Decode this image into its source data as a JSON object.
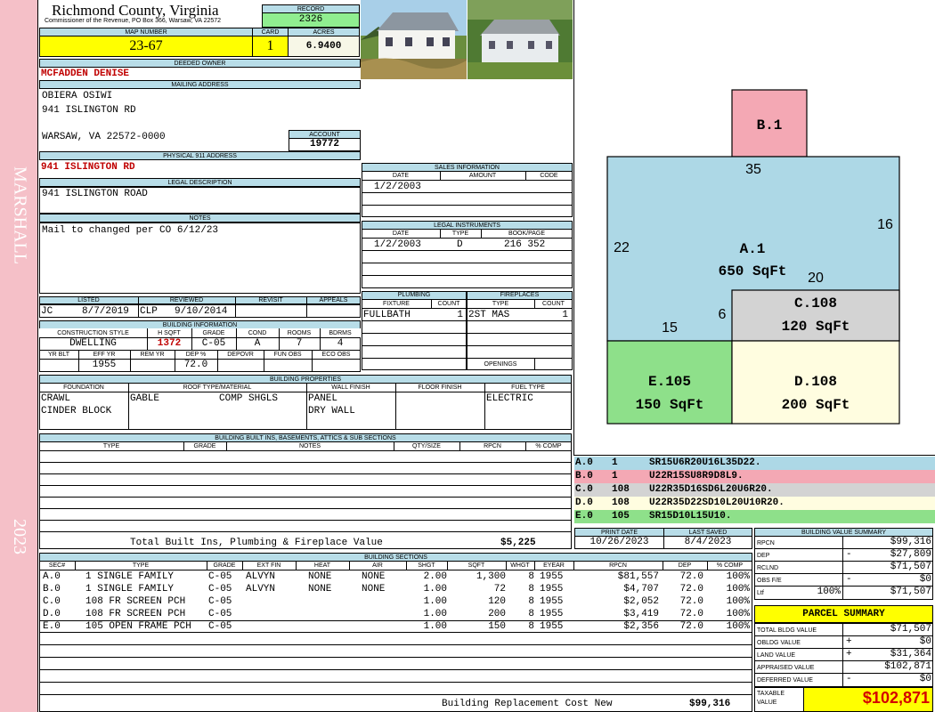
{
  "sidebar": {
    "subdivision": "MARSHALL",
    "year": "2023"
  },
  "header": {
    "county": "Richmond County, Virginia",
    "address_line": "Commissioner of the Revenue, PO Box 366, Warsaw, VA 22572",
    "record_label": "RECORD",
    "record": "2326",
    "map_label": "MAP NUMBER",
    "map_number": "23-67",
    "card_label": "CARD",
    "card": "1",
    "acres_label": "ACRES",
    "acres": "6.9400"
  },
  "owner": {
    "deeded_label": "DEEDED OWNER",
    "deeded_owner": "MCFADDEN DENISE",
    "mailing_label": "MAILING ADDRESS",
    "mail_line1": "OBIERA OSIWI",
    "mail_line2": "941 ISLINGTON RD",
    "mail_line3": "WARSAW, VA 22572-0000",
    "account_label": "ACCOUNT",
    "account": "19772",
    "physical_label": "PHYSICAL 911 ADDRESS",
    "physical_address": "941 ISLINGTON RD",
    "legal_label": "LEGAL DESCRIPTION",
    "legal": "941 ISLINGTON ROAD",
    "notes_label": "NOTES",
    "notes": "Mail to changed per CO 6/12/23"
  },
  "sales": {
    "title": "SALES INFORMATION",
    "cols": [
      "DATE",
      "AMOUNT",
      "CODE"
    ],
    "date": "1/2/2003",
    "amount": "",
    "code": ""
  },
  "legal_inst": {
    "title": "LEGAL INSTRUMENTS",
    "cols": [
      "DATE",
      "TYPE",
      "BOOK/PAGE"
    ],
    "date": "1/2/2003",
    "type": "D",
    "bookpage": "216 352"
  },
  "listed": {
    "labels": [
      "LISTED",
      "REVIEWED",
      "REVISIT",
      "APPEALS"
    ],
    "listed_by": "JC",
    "listed_date": "8/7/2019",
    "reviewed_by": "CLP",
    "reviewed_date": "9/10/2014"
  },
  "plumbing": {
    "title": "PLUMBING",
    "cols": [
      "FIXTURE",
      "COUNT"
    ],
    "fixture": "FULLBATH",
    "count": "1"
  },
  "fireplaces": {
    "title": "FIREPLACES",
    "cols": [
      "TYPE",
      "COUNT"
    ],
    "type": "2ST MAS",
    "count": "1",
    "openings": "OPENINGS"
  },
  "building_info": {
    "title": "BUILDING INFORMATION",
    "cols": [
      "CONSTRUCTION STYLE",
      "H SQFT",
      "GRADE",
      "COND",
      "ROOMS",
      "BDRMS"
    ],
    "style": "DWELLING",
    "hsqft": "1372",
    "grade": "C-05",
    "cond": "A",
    "rooms": "7",
    "bdrms": "4",
    "cols2": [
      "YR BLT",
      "EFF YR",
      "REM YR",
      "DEP %",
      "DEPOVR",
      "FUN OBS",
      "ECO OBS"
    ],
    "eff_yr": "1955",
    "dep": "72.0"
  },
  "properties": {
    "title": "BUILDING PROPERTIES",
    "cols": [
      "FOUNDATION",
      "ROOF TYPE/MATERIAL",
      "WALL FINISH",
      "FLOOR FINISH",
      "FUEL TYPE"
    ],
    "foundation1": "CRAWL",
    "foundation2": "CINDER BLOCK",
    "roof_type": "GABLE",
    "roof_mat": "COMP SHGLS",
    "wall1": "PANEL",
    "wall2": "DRY WALL",
    "fuel": "ELECTRIC"
  },
  "builtins": {
    "title": "BUILDING BUILT INS, BASEMENTS, ATTICS & SUB SECTIONS",
    "cols": [
      "TYPE",
      "GRADE",
      "NOTES",
      "QTY/SIZE",
      "RPCN",
      "% COMP"
    ],
    "total_label": "Total Built Ins, Plumbing & Fireplace Value",
    "total": "$5,225"
  },
  "print": {
    "print_label": "PRINT DATE",
    "print_date": "10/26/2023",
    "saved_label": "LAST SAVED",
    "saved_date": "8/4/2023"
  },
  "sections": {
    "title": "BUILDING SECTIONS",
    "cols": [
      "SEC#",
      "TYPE",
      "GRADE",
      "EXT FIN",
      "HEAT",
      "AIR",
      "SHGT",
      "SQFT",
      "WHGT",
      "EYEAR",
      "RPCN",
      "DEP",
      "% COMP"
    ],
    "rows": [
      {
        "sec": "A.0",
        "type": "1 SINGLE FAMILY",
        "grade": "C-05",
        "ext": "ALVYN",
        "heat": "NONE",
        "air": "NONE",
        "shgt": "2.00",
        "sqft": "1,300",
        "whgt": "8",
        "eyear": "1955",
        "rpcn": "$81,557",
        "dep": "72.0",
        "comp": "100%"
      },
      {
        "sec": "B.0",
        "type": "1 SINGLE FAMILY",
        "grade": "C-05",
        "ext": "ALVYN",
        "heat": "NONE",
        "air": "NONE",
        "shgt": "1.00",
        "sqft": "72",
        "whgt": "8",
        "eyear": "1955",
        "rpcn": "$4,707",
        "dep": "72.0",
        "comp": "100%"
      },
      {
        "sec": "C.0",
        "type": "108 FR SCREEN PCH",
        "grade": "C-05",
        "ext": "",
        "heat": "",
        "air": "",
        "shgt": "1.00",
        "sqft": "120",
        "whgt": "8",
        "eyear": "1955",
        "rpcn": "$2,052",
        "dep": "72.0",
        "comp": "100%"
      },
      {
        "sec": "D.0",
        "type": "108 FR SCREEN PCH",
        "grade": "C-05",
        "ext": "",
        "heat": "",
        "air": "",
        "shgt": "1.00",
        "sqft": "200",
        "whgt": "8",
        "eyear": "1955",
        "rpcn": "$3,419",
        "dep": "72.0",
        "comp": "100%"
      },
      {
        "sec": "E.0",
        "type": "105 OPEN FRAME PCH",
        "grade": "C-05",
        "ext": "",
        "heat": "",
        "air": "",
        "shgt": "1.00",
        "sqft": "150",
        "whgt": "8",
        "eyear": "1955",
        "rpcn": "$2,356",
        "dep": "72.0",
        "comp": "100%"
      }
    ],
    "total_label": "Building Replacement Cost New",
    "total": "$99,316"
  },
  "sketch": {
    "labels": {
      "b": "B.1",
      "a1": "A.1",
      "a2": "650 SqFt",
      "c1": "C.108",
      "c2": "120 SqFt",
      "d1": "D.108",
      "d2": "200 SqFt",
      "e1": "E.105",
      "e2": "150 SqFt"
    },
    "dims": {
      "d35": "35",
      "d16": "16",
      "d22": "22",
      "d20": "20",
      "d6": "6",
      "d15": "15"
    },
    "colors": {
      "a": "#add8e6",
      "b": "#f4a8b4",
      "c": "#d3d3d3",
      "d": "#fffde0",
      "e": "#8ee08a"
    },
    "vectors": [
      {
        "sec": "A.0",
        "code": "1",
        "path": "SR15U6R20U16L35D22."
      },
      {
        "sec": "B.0",
        "code": "1",
        "path": "U22R15SU8R9D8L9."
      },
      {
        "sec": "C.0",
        "code": "108",
        "path": "U22R35D16SD6L20U6R20."
      },
      {
        "sec": "D.0",
        "code": "108",
        "path": "U22R35D22SD10L20U10R20."
      },
      {
        "sec": "E.0",
        "code": "105",
        "path": "SR15D10L15U10."
      }
    ]
  },
  "bv": {
    "title": "BUILDING VALUE SUMMARY",
    "rpcn_label": "RPCN",
    "rpcn": "$99,316",
    "dep_label": "DEP",
    "dep_sign": "-",
    "dep": "$27,809",
    "rclnd_label": "RCLND",
    "rclnd": "$71,507",
    "obs_label": "OBS F/E",
    "obs_sign": "-",
    "obs": "$0",
    "ltf_label": "Ltf",
    "ltf_pct": "100%",
    "ltf": "$71,507"
  },
  "ps": {
    "title": "PARCEL SUMMARY",
    "bldg_label": "TOTAL BLDG VALUE",
    "bldg": "$71,507",
    "obldg_label": "OBLDG VALUE",
    "obldg_sign": "+",
    "obldg": "$0",
    "land_label": "LAND VALUE",
    "land_sign": "+",
    "land": "$31,364",
    "appr_label": "APPRAISED VALUE",
    "appr": "$102,871",
    "def_label": "DEFERRED VALUE",
    "def_sign": "-",
    "def": "$0",
    "tax_label1": "TAXABLE",
    "tax_label2": "VALUE",
    "tax": "$102,871"
  }
}
